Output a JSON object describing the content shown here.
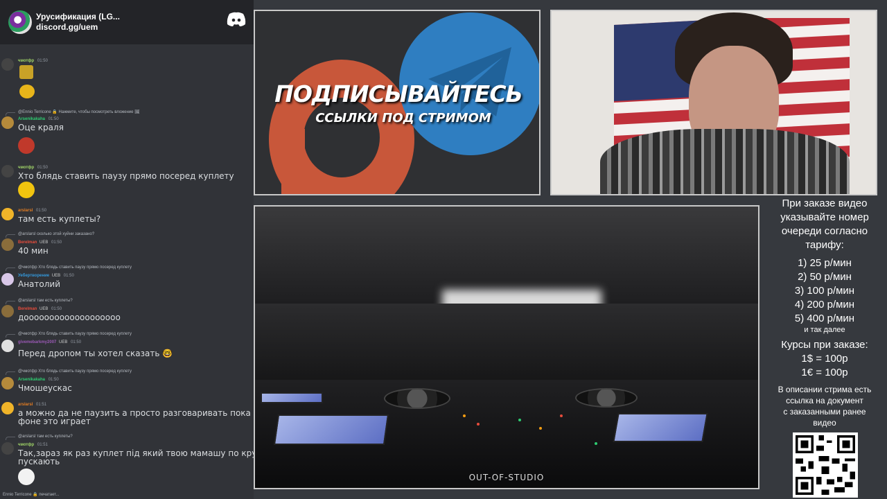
{
  "server": {
    "name": "Урусификация (LG...",
    "invite": "discord.gg/uem",
    "logo_icon": "discord-logo-icon"
  },
  "chat": {
    "messages": [
      {
        "user": "чмотфр",
        "time": "01:50",
        "color": "#a0d468"
      },
      {
        "reply": "@Ennio Terricone 🔒 Нажмите, чтобы посмотреть вложение 🖼"
      },
      {
        "user": "Arsenikakaha",
        "time": "01:50",
        "color": "#2ecc71",
        "text": "Оце краля"
      },
      {
        "user": "чмотфр",
        "time": "01:50",
        "color": "#a0d468",
        "text": "Хто блядь ставить паузу прямо посеред куплету"
      },
      {
        "user": "arslarsl",
        "time": "01:50",
        "color": "#e67e22",
        "text": "там есть куплеты?"
      },
      {
        "reply": "@arslarsl сколько этой хуйни заказано?"
      },
      {
        "user": "Berelman",
        "badge": "UEB",
        "time": "01:50",
        "color": "#e74c3c",
        "text": "40 мин"
      },
      {
        "reply": "@чмотфр Хто блядь ставить паузу прямо посеред куплету"
      },
      {
        "user": "Уебертворение",
        "badge": "UEB",
        "time": "01:50",
        "color": "#3498db",
        "text": "Анатолий"
      },
      {
        "reply": "@arslarsl там есть куплеты?"
      },
      {
        "user": "Berelman",
        "badge": "UEB",
        "time": "01:50",
        "color": "#e74c3c",
        "text": "дооооооооооооооооооо"
      },
      {
        "reply": "@чмотфр Хто блядь ставить паузу прямо посеред куплету"
      },
      {
        "user": "givemebarkmy2007",
        "badge": "UEB",
        "time": "01:50",
        "color": "#9b59b6",
        "text": "Перед дропом ты хотел сказать 🤓"
      },
      {
        "reply": "@чмотфр Хто блядь ставить паузу прямо посеред куплету"
      },
      {
        "user": "Arsenikakaha",
        "time": "01:50",
        "color": "#2ecc71",
        "text": "Чмошеускас"
      },
      {
        "user": "arslarsl",
        "time": "01:51",
        "color": "#e67e22",
        "text": "а можно да не паузить а просто разговаривать пока на",
        "text2": "фоне это играет"
      },
      {
        "reply": "@arslarsl там есть куплеты?"
      },
      {
        "user": "чмотфр",
        "time": "01:51",
        "color": "#a0d468",
        "text": "Так,зараз як раз куплет під який твою мамашу по кругу",
        "text2": "пускають"
      }
    ],
    "typing": "Ennio Terricone 🔒 печатает..."
  },
  "promo": {
    "title": "ПОДПИСЫВАЙТЕСЬ",
    "subtitle": "ССЫЛКИ ПОД СТРИМОМ"
  },
  "dj": {
    "watermark": "OUT-OF-STUDIO"
  },
  "info": {
    "heading_lines": [
      "При заказе видео",
      "указывайте номер",
      "очереди согласно",
      "тарифу:"
    ],
    "prices": [
      "1) 25 р/мин",
      "2) 50 р/мин",
      "3) 100 р/мин",
      "4) 200 р/мин",
      "5) 400 р/мин"
    ],
    "etc": "и так далее",
    "rates_title": "Курсы при заказе:",
    "rates": [
      "1$ = 100р",
      "1€ = 100р"
    ],
    "note_lines": [
      "В описании стрима есть",
      "ссылка на документ",
      "с заказанными ранее",
      "видео"
    ]
  },
  "colors": {
    "discord_bg": "#313338",
    "discord_header": "#232428",
    "telegram_blue": "#2f7ec1",
    "patreon_orange": "#c8573a"
  }
}
